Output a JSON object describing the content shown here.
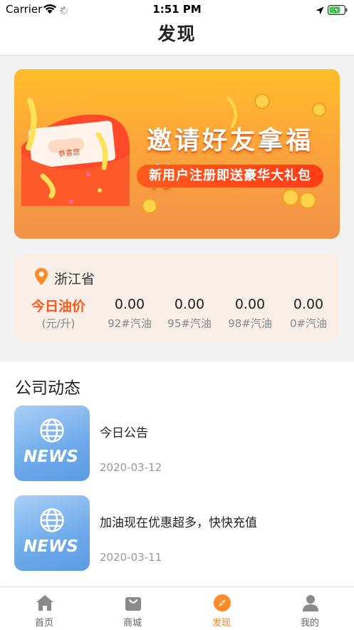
{
  "status_bar": {
    "carrier": "Carrier",
    "time": "1:51 PM"
  },
  "nav": {
    "title": "发现"
  },
  "banner": {
    "title": "邀请好友拿福利",
    "subtitle": "新用户注册即送豪华大礼包",
    "envelope_text": "恭喜您"
  },
  "fuel": {
    "province": "浙江省",
    "today_label": "今日油价",
    "unit_label": "(元/升)",
    "prices": [
      {
        "price": "0.00",
        "grade": "92#汽油"
      },
      {
        "price": "0.00",
        "grade": "95#汽油"
      },
      {
        "price": "0.00",
        "grade": "98#汽油"
      },
      {
        "price": "0.00",
        "grade": "0#汽油"
      }
    ]
  },
  "news": {
    "heading": "公司动态",
    "thumb_text": "NEWS",
    "items": [
      {
        "title": "今日公告",
        "date": "2020-03-12"
      },
      {
        "title": "加油现在优惠超多，快快充值",
        "date": "2020-03-11"
      }
    ]
  },
  "tabbar": {
    "tabs": [
      {
        "label": "首页",
        "icon": "home-icon"
      },
      {
        "label": "商城",
        "icon": "bag-icon"
      },
      {
        "label": "发现",
        "icon": "compass-icon"
      },
      {
        "label": "我的",
        "icon": "user-icon"
      }
    ],
    "active_index": 2
  },
  "colors": {
    "accent": "#ff7f2a",
    "price_orange": "#ff5a1a",
    "fuel_card_bg": "#f9efe8",
    "news_blue": "#6da9ea"
  }
}
